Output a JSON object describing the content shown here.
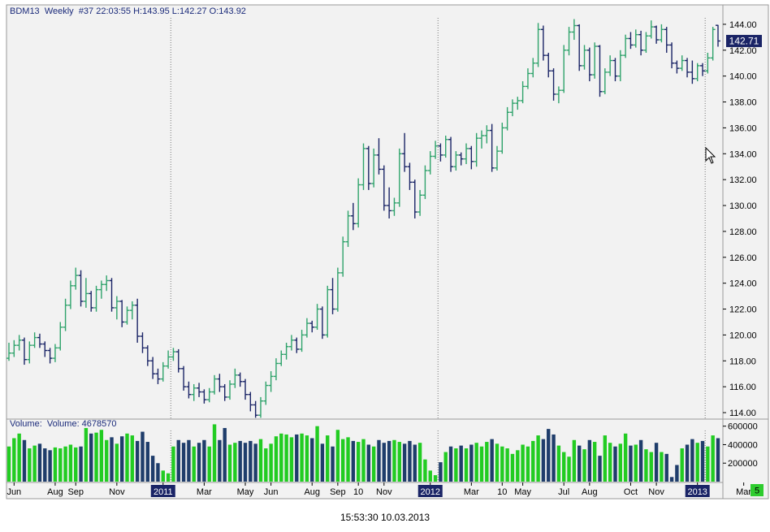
{
  "header": {
    "symbol": "BDM13",
    "period": "Weekly",
    "info": "#37 22:03:55 H:143.95 L:142.27 O:143.92"
  },
  "volume_panel": {
    "label": "Volume:",
    "value_text": "Volume: 4678570",
    "badge": "5"
  },
  "last_price_label": "142.71",
  "timestamp": "15:53:30 10.03.2013",
  "colors": {
    "up": "#2fa36b",
    "down": "#1a2466",
    "volume_up": "#22cc22",
    "volume_down": "#1f3d6b",
    "background": "#f2f2f2",
    "price_badge": "#1a2466",
    "volume_badge": "#2ecc2e"
  },
  "chart_data": {
    "type": "ohlc",
    "series_name": "BDM13",
    "period": "Weekly",
    "ylim": [
      113.5,
      145.5
    ],
    "yticks": [
      114.0,
      116.0,
      118.0,
      120.0,
      122.0,
      124.0,
      126.0,
      128.0,
      130.0,
      132.0,
      134.0,
      136.0,
      138.0,
      140.0,
      142.0,
      144.0
    ],
    "last_price": 142.71,
    "volume_ylim": [
      0,
      650000
    ],
    "volume_ticks": [
      200000,
      400000,
      600000
    ],
    "x_labels": [
      {
        "bar": 1,
        "text": "Jun",
        "boxed": false
      },
      {
        "bar": 9,
        "text": "Aug",
        "boxed": false
      },
      {
        "bar": 13,
        "text": "Sep",
        "boxed": false
      },
      {
        "bar": 21,
        "text": "Nov",
        "boxed": false
      },
      {
        "bar": 30,
        "text": "2011",
        "boxed": true
      },
      {
        "bar": 38,
        "text": "Mar",
        "boxed": false
      },
      {
        "bar": 46,
        "text": "May",
        "boxed": false
      },
      {
        "bar": 51,
        "text": "Jun",
        "boxed": false
      },
      {
        "bar": 59,
        "text": "Aug",
        "boxed": false
      },
      {
        "bar": 64,
        "text": "Sep",
        "boxed": false
      },
      {
        "bar": 68,
        "text": "10",
        "boxed": false
      },
      {
        "bar": 73,
        "text": "Nov",
        "boxed": false
      },
      {
        "bar": 82,
        "text": "2012",
        "boxed": true
      },
      {
        "bar": 90,
        "text": "Mar",
        "boxed": false
      },
      {
        "bar": 96,
        "text": "10",
        "boxed": false
      },
      {
        "bar": 100,
        "text": "May",
        "boxed": false
      },
      {
        "bar": 108,
        "text": "Jul",
        "boxed": false
      },
      {
        "bar": 113,
        "text": "Aug",
        "boxed": false
      },
      {
        "bar": 121,
        "text": "Oct",
        "boxed": false
      },
      {
        "bar": 126,
        "text": "Nov",
        "boxed": false
      },
      {
        "bar": 134,
        "text": "2013",
        "boxed": true
      },
      {
        "bar": 143,
        "text": "Mar",
        "boxed": false
      }
    ],
    "year_separators": [
      31.5,
      83.5,
      135.5
    ],
    "bars": [
      {
        "o": 118.2,
        "h": 119.4,
        "l": 118.0,
        "c": 118.6,
        "v": 380000
      },
      {
        "o": 118.6,
        "h": 119.6,
        "l": 118.3,
        "c": 119.2,
        "v": 470000
      },
      {
        "o": 119.2,
        "h": 120.0,
        "l": 118.8,
        "c": 119.6,
        "v": 520000
      },
      {
        "o": 119.6,
        "h": 119.8,
        "l": 117.7,
        "c": 118.1,
        "v": 450000
      },
      {
        "o": 118.1,
        "h": 119.5,
        "l": 117.8,
        "c": 119.2,
        "v": 360000
      },
      {
        "o": 119.2,
        "h": 120.2,
        "l": 119.0,
        "c": 119.8,
        "v": 390000
      },
      {
        "o": 119.8,
        "h": 120.1,
        "l": 119.0,
        "c": 119.3,
        "v": 410000
      },
      {
        "o": 119.3,
        "h": 119.5,
        "l": 118.3,
        "c": 118.8,
        "v": 360000
      },
      {
        "o": 118.8,
        "h": 119.0,
        "l": 117.8,
        "c": 118.2,
        "v": 340000
      },
      {
        "o": 118.2,
        "h": 119.3,
        "l": 117.9,
        "c": 119.0,
        "v": 370000
      },
      {
        "o": 119.0,
        "h": 121.0,
        "l": 118.8,
        "c": 120.6,
        "v": 360000
      },
      {
        "o": 120.6,
        "h": 122.8,
        "l": 120.3,
        "c": 122.3,
        "v": 380000
      },
      {
        "o": 122.3,
        "h": 124.2,
        "l": 122.0,
        "c": 123.8,
        "v": 400000
      },
      {
        "o": 123.8,
        "h": 125.2,
        "l": 123.5,
        "c": 124.6,
        "v": 370000
      },
      {
        "o": 124.6,
        "h": 125.0,
        "l": 122.2,
        "c": 122.6,
        "v": 380000
      },
      {
        "o": 122.6,
        "h": 124.4,
        "l": 122.1,
        "c": 123.2,
        "v": 580000
      },
      {
        "o": 123.2,
        "h": 123.4,
        "l": 121.8,
        "c": 122.1,
        "v": 520000
      },
      {
        "o": 122.1,
        "h": 123.8,
        "l": 121.8,
        "c": 123.5,
        "v": 530000
      },
      {
        "o": 123.5,
        "h": 124.2,
        "l": 122.8,
        "c": 123.9,
        "v": 560000
      },
      {
        "o": 123.9,
        "h": 124.6,
        "l": 123.4,
        "c": 124.2,
        "v": 450000
      },
      {
        "o": 124.2,
        "h": 124.4,
        "l": 121.8,
        "c": 122.1,
        "v": 480000
      },
      {
        "o": 122.1,
        "h": 123.0,
        "l": 121.2,
        "c": 122.6,
        "v": 410000
      },
      {
        "o": 122.6,
        "h": 122.7,
        "l": 120.6,
        "c": 121.0,
        "v": 490000
      },
      {
        "o": 121.0,
        "h": 122.2,
        "l": 120.8,
        "c": 121.9,
        "v": 520000
      },
      {
        "o": 121.9,
        "h": 122.6,
        "l": 121.2,
        "c": 122.3,
        "v": 500000
      },
      {
        "o": 122.3,
        "h": 122.8,
        "l": 119.4,
        "c": 119.9,
        "v": 440000
      },
      {
        "o": 119.9,
        "h": 120.2,
        "l": 118.6,
        "c": 119.0,
        "v": 540000
      },
      {
        "o": 119.0,
        "h": 119.2,
        "l": 117.6,
        "c": 118.0,
        "v": 430000
      },
      {
        "o": 118.0,
        "h": 118.3,
        "l": 116.6,
        "c": 117.0,
        "v": 280000
      },
      {
        "o": 117.0,
        "h": 117.4,
        "l": 116.2,
        "c": 116.6,
        "v": 200000
      },
      {
        "o": 116.6,
        "h": 117.9,
        "l": 116.4,
        "c": 117.6,
        "v": 120000
      },
      {
        "o": 117.6,
        "h": 118.8,
        "l": 117.4,
        "c": 118.3,
        "v": 90000
      },
      {
        "o": 118.3,
        "h": 119.0,
        "l": 118.0,
        "c": 118.7,
        "v": 380000
      },
      {
        "o": 118.7,
        "h": 118.9,
        "l": 117.1,
        "c": 117.4,
        "v": 450000
      },
      {
        "o": 117.4,
        "h": 117.6,
        "l": 115.7,
        "c": 116.0,
        "v": 420000
      },
      {
        "o": 116.0,
        "h": 116.4,
        "l": 115.1,
        "c": 115.4,
        "v": 450000
      },
      {
        "o": 115.4,
        "h": 116.2,
        "l": 114.9,
        "c": 115.9,
        "v": 380000
      },
      {
        "o": 115.9,
        "h": 116.3,
        "l": 115.2,
        "c": 115.6,
        "v": 420000
      },
      {
        "o": 115.6,
        "h": 115.8,
        "l": 114.7,
        "c": 115.0,
        "v": 450000
      },
      {
        "o": 115.0,
        "h": 115.9,
        "l": 114.8,
        "c": 115.6,
        "v": 380000
      },
      {
        "o": 115.6,
        "h": 116.9,
        "l": 115.4,
        "c": 116.6,
        "v": 620000
      },
      {
        "o": 116.6,
        "h": 117.0,
        "l": 115.6,
        "c": 116.0,
        "v": 450000
      },
      {
        "o": 116.0,
        "h": 116.2,
        "l": 114.9,
        "c": 115.2,
        "v": 580000
      },
      {
        "o": 115.2,
        "h": 116.5,
        "l": 115.0,
        "c": 116.2,
        "v": 400000
      },
      {
        "o": 116.2,
        "h": 117.4,
        "l": 115.9,
        "c": 116.9,
        "v": 420000
      },
      {
        "o": 116.9,
        "h": 117.1,
        "l": 116.0,
        "c": 116.4,
        "v": 440000
      },
      {
        "o": 116.4,
        "h": 116.6,
        "l": 115.0,
        "c": 115.4,
        "v": 420000
      },
      {
        "o": 115.4,
        "h": 115.6,
        "l": 114.1,
        "c": 114.6,
        "v": 440000
      },
      {
        "o": 114.6,
        "h": 114.9,
        "l": 113.6,
        "c": 113.8,
        "v": 410000
      },
      {
        "o": 113.8,
        "h": 115.2,
        "l": 113.6,
        "c": 114.9,
        "v": 460000
      },
      {
        "o": 114.9,
        "h": 116.4,
        "l": 114.6,
        "c": 116.1,
        "v": 360000
      },
      {
        "o": 116.1,
        "h": 117.2,
        "l": 115.6,
        "c": 116.8,
        "v": 410000
      },
      {
        "o": 116.8,
        "h": 118.2,
        "l": 116.5,
        "c": 117.8,
        "v": 490000
      },
      {
        "o": 117.8,
        "h": 118.8,
        "l": 117.6,
        "c": 118.5,
        "v": 520000
      },
      {
        "o": 118.5,
        "h": 119.4,
        "l": 118.1,
        "c": 119.1,
        "v": 510000
      },
      {
        "o": 119.1,
        "h": 120.0,
        "l": 118.8,
        "c": 119.6,
        "v": 480000
      },
      {
        "o": 119.6,
        "h": 119.8,
        "l": 118.6,
        "c": 118.9,
        "v": 510000
      },
      {
        "o": 118.9,
        "h": 120.4,
        "l": 118.7,
        "c": 120.0,
        "v": 520000
      },
      {
        "o": 120.0,
        "h": 121.3,
        "l": 119.8,
        "c": 120.9,
        "v": 500000
      },
      {
        "o": 120.9,
        "h": 121.1,
        "l": 120.2,
        "c": 120.6,
        "v": 470000
      },
      {
        "o": 120.6,
        "h": 122.4,
        "l": 120.4,
        "c": 122.0,
        "v": 600000
      },
      {
        "o": 122.0,
        "h": 122.2,
        "l": 119.7,
        "c": 120.0,
        "v": 410000
      },
      {
        "o": 120.0,
        "h": 123.8,
        "l": 119.8,
        "c": 123.5,
        "v": 500000
      },
      {
        "o": 123.5,
        "h": 124.4,
        "l": 121.6,
        "c": 122.0,
        "v": 380000
      },
      {
        "o": 122.0,
        "h": 125.2,
        "l": 121.8,
        "c": 124.8,
        "v": 560000
      },
      {
        "o": 124.8,
        "h": 127.6,
        "l": 124.5,
        "c": 127.2,
        "v": 460000
      },
      {
        "o": 127.2,
        "h": 129.6,
        "l": 126.8,
        "c": 129.2,
        "v": 480000
      },
      {
        "o": 129.2,
        "h": 130.2,
        "l": 128.1,
        "c": 128.6,
        "v": 440000
      },
      {
        "o": 128.6,
        "h": 132.1,
        "l": 128.3,
        "c": 131.6,
        "v": 430000
      },
      {
        "o": 131.6,
        "h": 134.8,
        "l": 131.2,
        "c": 134.4,
        "v": 460000
      },
      {
        "o": 134.4,
        "h": 134.6,
        "l": 131.2,
        "c": 131.7,
        "v": 400000
      },
      {
        "o": 131.7,
        "h": 134.4,
        "l": 131.4,
        "c": 133.9,
        "v": 380000
      },
      {
        "o": 133.9,
        "h": 135.2,
        "l": 132.4,
        "c": 132.8,
        "v": 450000
      },
      {
        "o": 132.8,
        "h": 133.1,
        "l": 129.6,
        "c": 130.0,
        "v": 420000
      },
      {
        "o": 130.0,
        "h": 131.4,
        "l": 129.0,
        "c": 129.6,
        "v": 440000
      },
      {
        "o": 129.6,
        "h": 130.6,
        "l": 129.2,
        "c": 130.2,
        "v": 450000
      },
      {
        "o": 130.2,
        "h": 134.4,
        "l": 129.9,
        "c": 134.0,
        "v": 430000
      },
      {
        "o": 134.0,
        "h": 135.6,
        "l": 132.6,
        "c": 133.0,
        "v": 410000
      },
      {
        "o": 133.0,
        "h": 133.3,
        "l": 131.2,
        "c": 131.8,
        "v": 440000
      },
      {
        "o": 131.8,
        "h": 132.0,
        "l": 129.0,
        "c": 129.5,
        "v": 400000
      },
      {
        "o": 129.5,
        "h": 131.2,
        "l": 129.2,
        "c": 130.8,
        "v": 420000
      },
      {
        "o": 130.8,
        "h": 133.1,
        "l": 130.5,
        "c": 132.7,
        "v": 240000
      },
      {
        "o": 132.7,
        "h": 134.2,
        "l": 132.4,
        "c": 133.8,
        "v": 120000
      },
      {
        "o": 133.8,
        "h": 135.0,
        "l": 133.6,
        "c": 134.6,
        "v": 70000
      },
      {
        "o": 134.6,
        "h": 134.8,
        "l": 133.4,
        "c": 133.9,
        "v": 210000
      },
      {
        "o": 133.9,
        "h": 135.4,
        "l": 133.7,
        "c": 135.1,
        "v": 320000
      },
      {
        "o": 135.1,
        "h": 135.3,
        "l": 132.6,
        "c": 133.0,
        "v": 380000
      },
      {
        "o": 133.0,
        "h": 134.2,
        "l": 132.7,
        "c": 133.9,
        "v": 360000
      },
      {
        "o": 133.9,
        "h": 134.1,
        "l": 133.1,
        "c": 133.6,
        "v": 390000
      },
      {
        "o": 133.6,
        "h": 134.8,
        "l": 133.2,
        "c": 134.4,
        "v": 360000
      },
      {
        "o": 134.4,
        "h": 134.6,
        "l": 132.8,
        "c": 133.4,
        "v": 400000
      },
      {
        "o": 133.4,
        "h": 135.6,
        "l": 133.0,
        "c": 135.2,
        "v": 420000
      },
      {
        "o": 135.2,
        "h": 135.8,
        "l": 134.4,
        "c": 135.4,
        "v": 380000
      },
      {
        "o": 135.4,
        "h": 136.2,
        "l": 134.8,
        "c": 135.8,
        "v": 430000
      },
      {
        "o": 135.8,
        "h": 136.3,
        "l": 132.6,
        "c": 132.9,
        "v": 460000
      },
      {
        "o": 132.9,
        "h": 134.6,
        "l": 132.7,
        "c": 134.2,
        "v": 410000
      },
      {
        "o": 134.2,
        "h": 136.4,
        "l": 134.0,
        "c": 136.0,
        "v": 380000
      },
      {
        "o": 136.0,
        "h": 137.6,
        "l": 135.8,
        "c": 137.2,
        "v": 360000
      },
      {
        "o": 137.2,
        "h": 138.2,
        "l": 136.9,
        "c": 137.9,
        "v": 300000
      },
      {
        "o": 137.9,
        "h": 138.4,
        "l": 137.4,
        "c": 138.1,
        "v": 340000
      },
      {
        "o": 138.1,
        "h": 139.6,
        "l": 137.9,
        "c": 139.2,
        "v": 400000
      },
      {
        "o": 139.2,
        "h": 140.6,
        "l": 139.0,
        "c": 140.2,
        "v": 380000
      },
      {
        "o": 140.2,
        "h": 141.4,
        "l": 139.9,
        "c": 141.0,
        "v": 440000
      },
      {
        "o": 141.0,
        "h": 144.1,
        "l": 140.7,
        "c": 143.6,
        "v": 500000
      },
      {
        "o": 143.6,
        "h": 143.9,
        "l": 141.2,
        "c": 141.6,
        "v": 460000
      },
      {
        "o": 141.6,
        "h": 141.8,
        "l": 139.9,
        "c": 140.4,
        "v": 570000
      },
      {
        "o": 140.4,
        "h": 140.6,
        "l": 138.1,
        "c": 138.6,
        "v": 510000
      },
      {
        "o": 138.6,
        "h": 139.2,
        "l": 137.9,
        "c": 138.9,
        "v": 390000
      },
      {
        "o": 138.9,
        "h": 142.4,
        "l": 138.7,
        "c": 142.0,
        "v": 320000
      },
      {
        "o": 142.0,
        "h": 143.8,
        "l": 141.6,
        "c": 143.4,
        "v": 270000
      },
      {
        "o": 143.4,
        "h": 144.4,
        "l": 142.8,
        "c": 143.9,
        "v": 450000
      },
      {
        "o": 143.9,
        "h": 144.0,
        "l": 140.4,
        "c": 140.8,
        "v": 390000
      },
      {
        "o": 140.8,
        "h": 142.4,
        "l": 140.5,
        "c": 142.0,
        "v": 350000
      },
      {
        "o": 142.0,
        "h": 142.2,
        "l": 139.6,
        "c": 140.1,
        "v": 450000
      },
      {
        "o": 140.1,
        "h": 142.6,
        "l": 139.8,
        "c": 142.3,
        "v": 430000
      },
      {
        "o": 142.3,
        "h": 142.4,
        "l": 138.4,
        "c": 138.8,
        "v": 280000
      },
      {
        "o": 138.8,
        "h": 140.6,
        "l": 138.6,
        "c": 140.3,
        "v": 500000
      },
      {
        "o": 140.3,
        "h": 141.6,
        "l": 140.0,
        "c": 141.2,
        "v": 420000
      },
      {
        "o": 141.2,
        "h": 141.4,
        "l": 139.6,
        "c": 140.0,
        "v": 380000
      },
      {
        "o": 140.0,
        "h": 142.0,
        "l": 139.6,
        "c": 141.6,
        "v": 410000
      },
      {
        "o": 141.6,
        "h": 143.2,
        "l": 141.4,
        "c": 142.9,
        "v": 520000
      },
      {
        "o": 142.9,
        "h": 143.4,
        "l": 142.1,
        "c": 142.4,
        "v": 390000
      },
      {
        "o": 142.4,
        "h": 143.6,
        "l": 142.2,
        "c": 143.2,
        "v": 400000
      },
      {
        "o": 143.2,
        "h": 143.5,
        "l": 141.6,
        "c": 142.0,
        "v": 450000
      },
      {
        "o": 142.0,
        "h": 143.4,
        "l": 141.8,
        "c": 143.1,
        "v": 350000
      },
      {
        "o": 143.1,
        "h": 144.3,
        "l": 142.9,
        "c": 143.8,
        "v": 320000
      },
      {
        "o": 143.8,
        "h": 143.9,
        "l": 142.5,
        "c": 142.8,
        "v": 420000
      },
      {
        "o": 142.8,
        "h": 144.0,
        "l": 142.6,
        "c": 143.6,
        "v": 320000
      },
      {
        "o": 143.6,
        "h": 143.8,
        "l": 141.8,
        "c": 142.4,
        "v": 300000
      },
      {
        "o": 142.4,
        "h": 142.6,
        "l": 140.6,
        "c": 141.0,
        "v": 50000
      },
      {
        "o": 141.0,
        "h": 141.2,
        "l": 140.2,
        "c": 140.6,
        "v": 180000
      },
      {
        "o": 140.6,
        "h": 141.6,
        "l": 140.4,
        "c": 141.2,
        "v": 360000
      },
      {
        "o": 141.2,
        "h": 141.4,
        "l": 139.9,
        "c": 140.3,
        "v": 400000
      },
      {
        "o": 140.3,
        "h": 141.2,
        "l": 139.4,
        "c": 139.8,
        "v": 460000
      },
      {
        "o": 139.8,
        "h": 141.0,
        "l": 139.6,
        "c": 140.8,
        "v": 420000
      },
      {
        "o": 140.8,
        "h": 141.0,
        "l": 140.0,
        "c": 140.4,
        "v": 440000
      },
      {
        "o": 140.4,
        "h": 141.8,
        "l": 140.2,
        "c": 141.4,
        "v": 380000
      },
      {
        "o": 141.4,
        "h": 143.8,
        "l": 141.2,
        "c": 143.6,
        "v": 500000
      },
      {
        "o": 143.92,
        "h": 143.95,
        "l": 142.27,
        "c": 142.71,
        "v": 470000
      }
    ]
  }
}
